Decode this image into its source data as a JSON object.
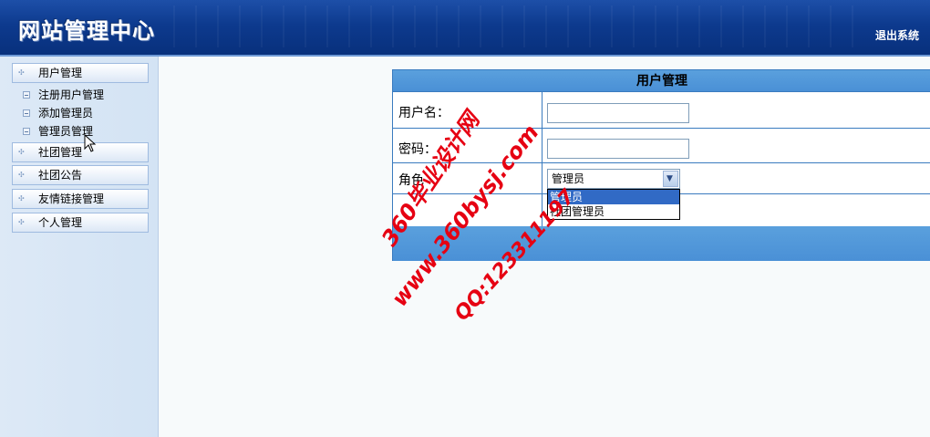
{
  "header": {
    "logo": "网站管理中心",
    "logout_label": "退出系统"
  },
  "sidebar": {
    "menus": [
      {
        "label": "用户管理",
        "sub_items": [
          "注册用户管理",
          "添加管理员",
          "管理员管理"
        ]
      },
      {
        "label": "社团管理"
      },
      {
        "label": "社团公告"
      },
      {
        "label": "友情链接管理"
      },
      {
        "label": "个人管理"
      }
    ]
  },
  "form": {
    "title": "用户管理",
    "username_label": "用户名：",
    "username_value": "",
    "password_label": "密码：",
    "password_value": "",
    "role_label": "角色",
    "role_selected": "管理员",
    "role_options": [
      "管理员",
      "社团管理员"
    ]
  },
  "watermark": {
    "line1": "360毕业设计网",
    "line2": "www.360bysj.com",
    "line3": "QQ:123311197"
  },
  "colors": {
    "header_bg": "#0d3a8e",
    "table_header_bg": "#4a90d6",
    "watermark": "#e60012",
    "selected_option": "#316ac5"
  }
}
